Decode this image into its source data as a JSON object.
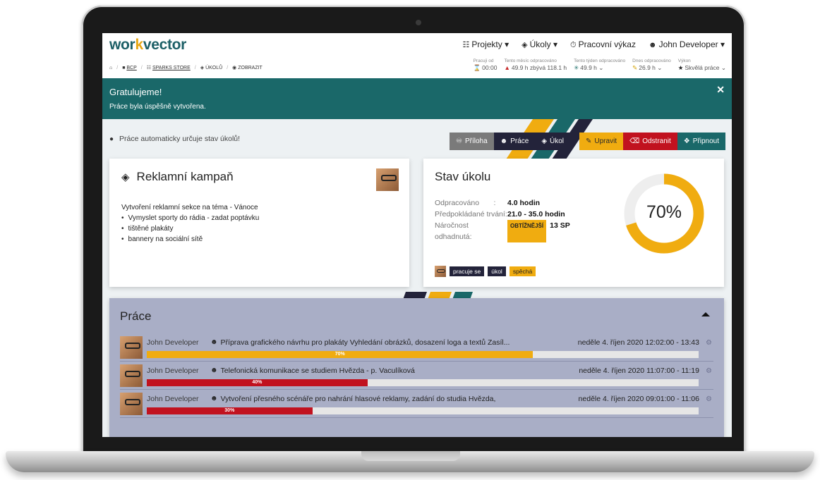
{
  "brand": {
    "logo_pre": "wor",
    "logo_hl": "k",
    "logo_post": "vector"
  },
  "nav": {
    "projects": "Projekty",
    "tasks": "Úkoly",
    "timesheet": "Pracovní výkaz",
    "user": "John Developer"
  },
  "breadcrumb": [
    "BCP",
    "SPARKS STORE",
    "ÚKOLŮ",
    "ZOBRAZIT"
  ],
  "stats": [
    {
      "label": "Pracuji od",
      "value": "00:00"
    },
    {
      "label": "Tento měsíc odpracováno",
      "value": "49.9 h zbývá 118.1 h"
    },
    {
      "label": "Tento týden odpracováno",
      "value": "49.9 h"
    },
    {
      "label": "Dnes odpracováno",
      "value": "26.9 h"
    },
    {
      "label": "Výkon",
      "value": "Skvělá práce"
    }
  ],
  "alert": {
    "title": "Gratulujeme!",
    "text": "Práce byla úspěšně vytvořena."
  },
  "info_note": "Práce automaticky určuje stav úkolů!",
  "buttons": {
    "attachment": "Příloha",
    "work": "Práce",
    "task": "Úkol",
    "edit": "Upravit",
    "delete": "Odstranit",
    "pin": "Připnout"
  },
  "task": {
    "title": "Reklamní kampaň",
    "description_intro": "Vytvoření reklamní sekce na téma - Vánoce",
    "description_items": [
      "Vymyslet sporty do rádia -  zadat poptávku",
      "tištěné plakáty",
      "bannery na sociální sítě"
    ]
  },
  "status": {
    "title": "Stav úkolu",
    "worked_label": "Odpracováno",
    "worked_value": "4.0 hodin",
    "expected_label": "Předpokládané trvání:",
    "expected_value": "21.0 - 35.0 hodin",
    "difficulty_label": "Náročnost odhadnutá:",
    "difficulty_badge": "OBTÍŽNĚJŠÍ",
    "difficulty_value": "13 SP",
    "progress": 0.7,
    "progress_label": "70%",
    "tags": [
      "pracuje se",
      "úkol",
      "spěchá"
    ],
    "colors": {
      "progress": "#f0ac10",
      "track": "#eeeeee"
    }
  },
  "works": {
    "title": "Práce",
    "rows": [
      {
        "user": "John Developer",
        "task": "Příprava grafického návrhu pro plakáty Vyhledání obrázků, dosazení loga a textů Zasíl...",
        "when": "neděle 4. říjen 2020 12:02:00 - 13:43",
        "progress": 0.7,
        "progress_label": "70%",
        "color": "yellow"
      },
      {
        "user": "John Developer",
        "task": "Telefonická komunikace se studiem Hvězda - p. Vaculíková",
        "when": "neděle 4. říjen 2020 11:07:00 - 11:19",
        "progress": 0.4,
        "progress_label": "40%",
        "color": "red"
      },
      {
        "user": "John Developer",
        "task": "Vytvoření přesného scénáře pro nahrání hlasové reklamy, zadání do studia Hvězda,",
        "when": "neděle 4. říjen 2020 09:01:00 - 11:06",
        "progress": 0.3,
        "progress_label": "30%",
        "color": "red"
      }
    ]
  }
}
